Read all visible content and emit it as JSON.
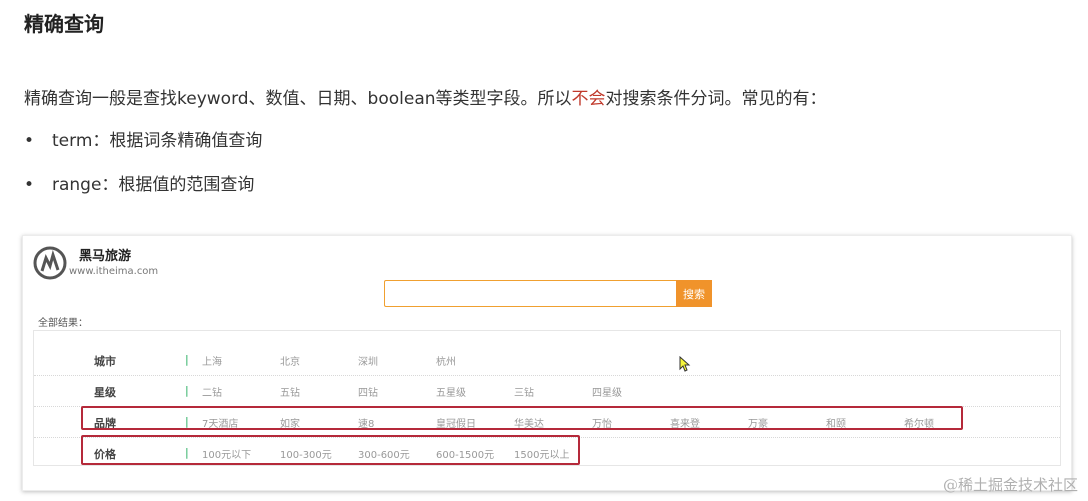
{
  "doc": {
    "title": "精确查询",
    "intro_prefix": "精确查询一般是查找keyword、数值、日期、boolean等类型字段。所以",
    "intro_emphasis": "不会",
    "intro_suffix": "对搜索条件分词。常见的有：",
    "bullets": [
      {
        "marker": "•",
        "text": "term：根据词条精确值查询"
      },
      {
        "marker": "•",
        "text": "range：根据值的范围查询"
      }
    ],
    "emphasis_color": "#c0392b"
  },
  "app": {
    "brand_name": "黑马旅游",
    "brand_url": "www.itheima.com",
    "search": {
      "value": "",
      "button_label": "搜索"
    },
    "all_results_label": "全部结果：",
    "separator": "|",
    "filters": [
      {
        "label": "城市",
        "options": [
          "上海",
          "北京",
          "深圳",
          "杭州"
        ]
      },
      {
        "label": "星级",
        "options": [
          "二钻",
          "五钻",
          "四钻",
          "五星级",
          "三钻",
          "四星级"
        ]
      },
      {
        "label": "品牌",
        "options": [
          "7天酒店",
          "如家",
          "速8",
          "皇冠假日",
          "华美达",
          "万怡",
          "喜来登",
          "万豪",
          "和颐",
          "希尔顿"
        ]
      },
      {
        "label": "价格",
        "options": [
          "100元以下",
          "100-300元",
          "300-600元",
          "600-1500元",
          "1500元以上"
        ]
      }
    ],
    "accent_color": "#f0932b",
    "highlight_color": "#b5293a"
  },
  "watermark": "@稀土掘金技术社区"
}
